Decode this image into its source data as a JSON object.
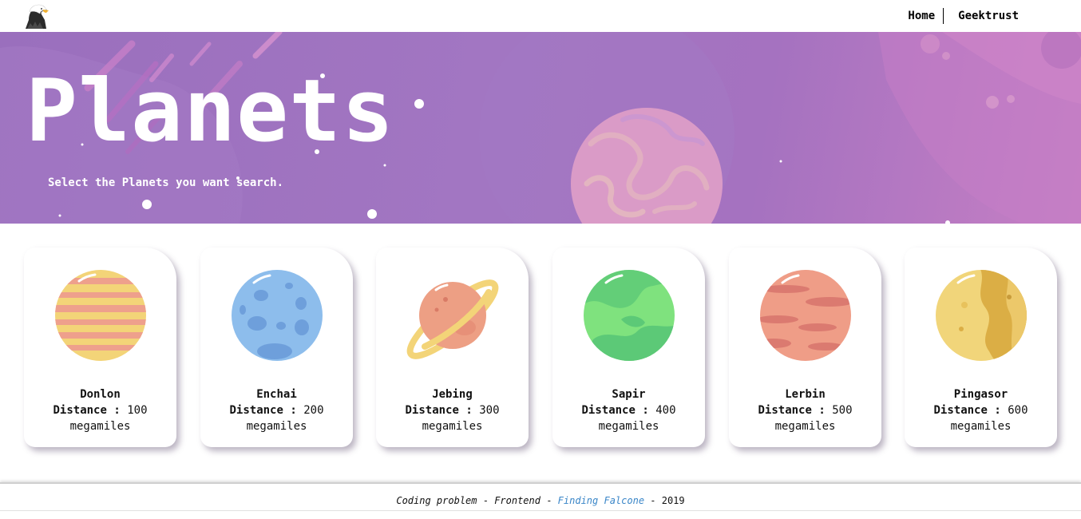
{
  "header": {
    "logo_icon": "eagle-logo-icon",
    "nav": {
      "home": "Home",
      "geektrust": "Geektrust"
    }
  },
  "hero": {
    "title": "Planets",
    "subtitle": "Select the Planets you want search."
  },
  "planets": [
    {
      "name": "Donlon",
      "distance_label": "Distance :",
      "distance": "100",
      "unit": "megamiles",
      "icon": "striped-yellow-planet-icon"
    },
    {
      "name": "Enchai",
      "distance_label": "Distance :",
      "distance": "200",
      "unit": "megamiles",
      "icon": "blue-crater-planet-icon"
    },
    {
      "name": "Jebing",
      "distance_label": "Distance :",
      "distance": "300",
      "unit": "megamiles",
      "icon": "ringed-planet-icon"
    },
    {
      "name": "Sapir",
      "distance_label": "Distance :",
      "distance": "400",
      "unit": "megamiles",
      "icon": "green-planet-icon"
    },
    {
      "name": "Lerbin",
      "distance_label": "Distance :",
      "distance": "500",
      "unit": "megamiles",
      "icon": "red-planet-icon"
    },
    {
      "name": "Pingasor",
      "distance_label": "Distance :",
      "distance": "600",
      "unit": "megamiles",
      "icon": "golden-planet-icon"
    }
  ],
  "footer": {
    "part1": "Coding problem",
    "sep1": " - ",
    "part2": "Frontend",
    "sep2": " - ",
    "link": "Finding Falcone",
    "sep3": " - ",
    "year": "2019"
  },
  "colors": {
    "hero_start": "#9a6fbd",
    "hero_end": "#c67fc4",
    "footer_link": "#3a86c8"
  }
}
